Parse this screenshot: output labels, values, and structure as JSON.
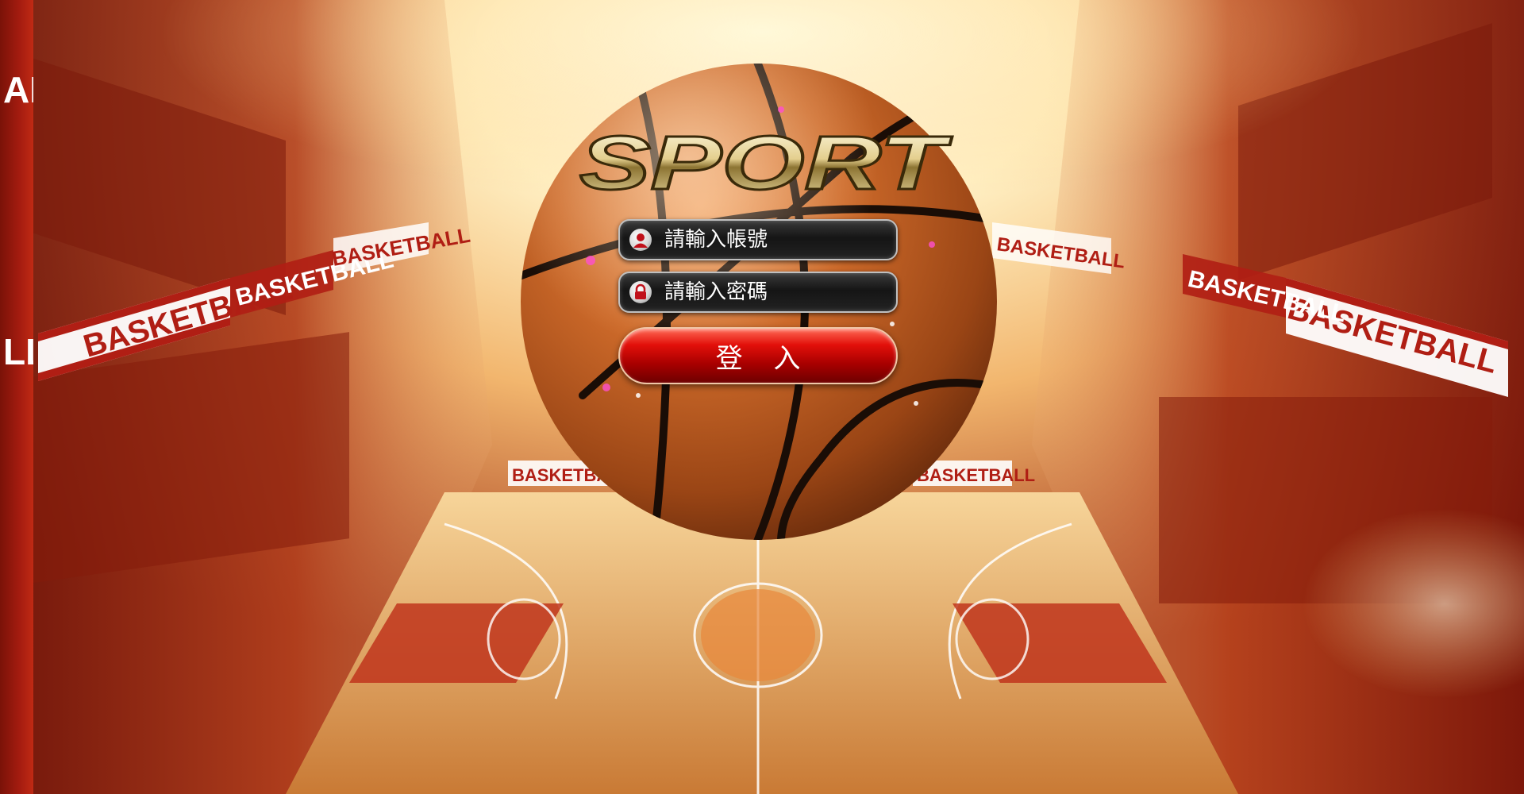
{
  "logo": {
    "text": "SPORT"
  },
  "background": {
    "banner_text": "BASKETBALL",
    "left_strip_text": "AL",
    "left_strip_text_2": "LL"
  },
  "login_form": {
    "username": {
      "value": "",
      "placeholder": "請輸入帳號",
      "icon": "user-icon"
    },
    "password": {
      "value": "",
      "placeholder": "請輸入密碼",
      "icon": "lock-icon"
    },
    "submit_label": "登 入"
  },
  "colors": {
    "button_red": "#d00000",
    "field_dark": "#1a1a1a",
    "ball_orange": "#c8611e",
    "banner_red": "#b01e14",
    "logo_gold": "#e9d9a6"
  }
}
